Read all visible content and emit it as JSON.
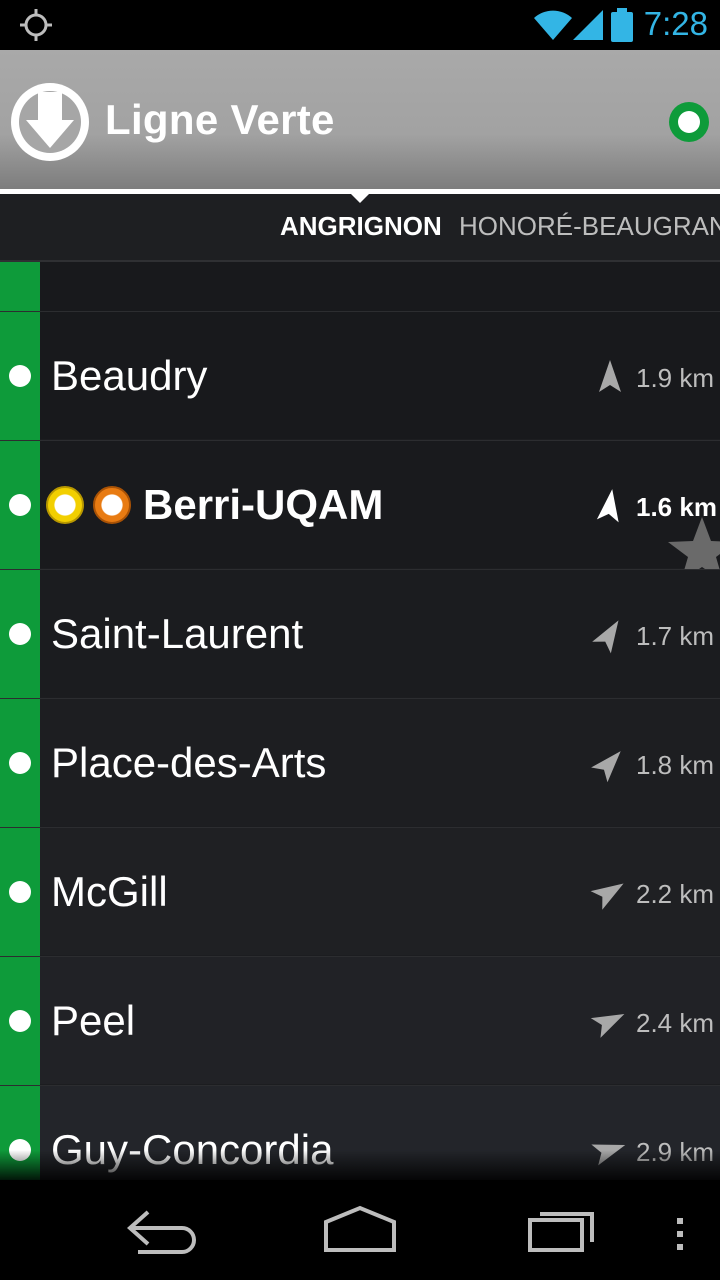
{
  "status_bar": {
    "time": "7:28",
    "icons": [
      "gps-icon",
      "wifi-icon",
      "signal-icon",
      "battery-icon"
    ],
    "accent_color": "#33b5e5"
  },
  "action_bar": {
    "title": "Ligne Verte",
    "logo_icon": "metro-logo-icon",
    "line_color": "#0e9b3a"
  },
  "directions": {
    "active": "ANGRIGNON",
    "other": "HONORÉ-BEAUGRAN"
  },
  "stations": [
    {
      "name": "Beaudry",
      "distance": "1.9 km",
      "transfers": [],
      "highlight": false
    },
    {
      "name": "Berri-UQAM",
      "distance": "1.6 km",
      "transfers": [
        "yellow",
        "orange"
      ],
      "highlight": true
    },
    {
      "name": "Saint-Laurent",
      "distance": "1.7 km",
      "transfers": [],
      "highlight": false
    },
    {
      "name": "Place-des-Arts",
      "distance": "1.8 km",
      "transfers": [],
      "highlight": false
    },
    {
      "name": "McGill",
      "distance": "2.2 km",
      "transfers": [],
      "highlight": false
    },
    {
      "name": "Peel",
      "distance": "2.4 km",
      "transfers": [],
      "highlight": false
    },
    {
      "name": "Guy-Concordia",
      "distance": "2.9 km",
      "transfers": [],
      "highlight": false
    }
  ],
  "colors": {
    "line_green": "#0e9b3a",
    "transfer_yellow": "#f2cf00",
    "transfer_orange": "#e87b12"
  },
  "nav_bar": {
    "icons": [
      "back-icon",
      "home-icon",
      "recents-icon",
      "overflow-menu-icon"
    ]
  }
}
